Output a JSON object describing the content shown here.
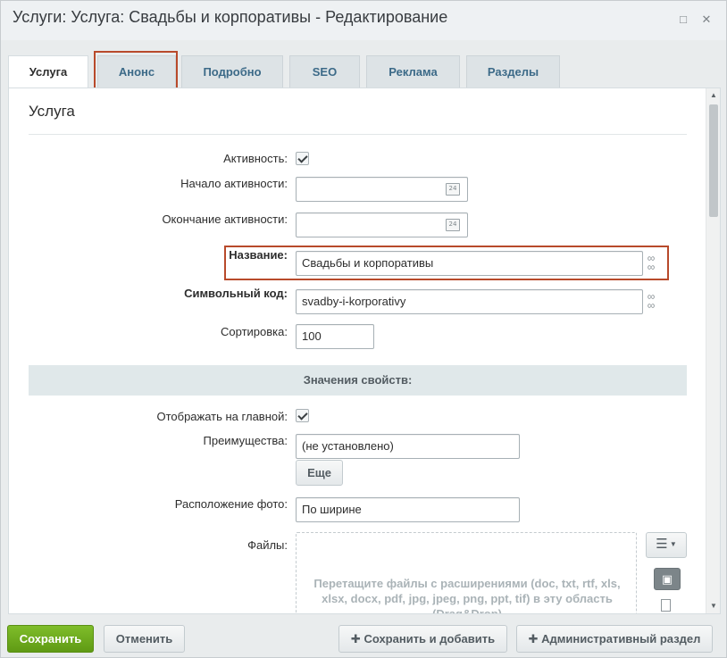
{
  "window": {
    "title": "Услуги: Услуга: Свадьбы и корпоративы - Редактирование",
    "maximize_icon": "maximize-icon",
    "close_icon": "close-icon"
  },
  "tabs": [
    {
      "label": "Услуга",
      "active": true
    },
    {
      "label": "Анонс",
      "active": false
    },
    {
      "label": "Подробно",
      "active": false
    },
    {
      "label": "SEO",
      "active": false
    },
    {
      "label": "Реклама",
      "active": false
    },
    {
      "label": "Разделы",
      "active": false
    }
  ],
  "section": {
    "title": "Услуга"
  },
  "fields": {
    "active": {
      "label": "Активность:",
      "checked": true
    },
    "active_from": {
      "label": "Начало активности:",
      "value": "",
      "calendar_text": "24"
    },
    "active_to": {
      "label": "Окончание активности:",
      "value": "",
      "calendar_text": "24"
    },
    "name": {
      "label": "Название:",
      "value": "Свадьбы и корпоративы"
    },
    "code": {
      "label": "Символьный код:",
      "value": "svadby-i-korporativy"
    },
    "sort": {
      "label": "Сортировка:",
      "value": "100"
    }
  },
  "properties": {
    "header": "Значения свойств:",
    "show_on_main": {
      "label": "Отображать на главной:",
      "checked": true
    },
    "advantages": {
      "label": "Преимущества:",
      "value": "(не установлено)",
      "more_button": "Еще"
    },
    "photo_position": {
      "label": "Расположение фото:",
      "value": "По ширине"
    },
    "files": {
      "label": "Файлы:",
      "dropzone_text": "Перетащите файлы с расширениями (doc, txt, rtf, xls, xlsx, docx, pdf, jpg, jpeg, png, ppt, tif) в эту область (Drag&Drop)"
    }
  },
  "footer": {
    "save": "Сохранить",
    "cancel": "Отменить",
    "save_and_add": "Сохранить и добавить",
    "admin_section": "Административный раздел"
  },
  "colors": {
    "save_green": "#6aa81d",
    "highlight": "#b84a2b",
    "tab_text": "#3c6a88"
  }
}
